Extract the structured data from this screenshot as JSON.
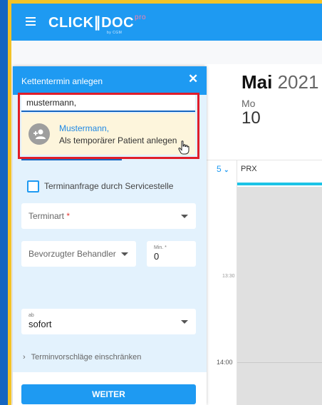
{
  "app": {
    "logo_text": "CLICK∥DOC",
    "logo_pro": "pro",
    "logo_by": "by CGM"
  },
  "calendar": {
    "month": "Mai",
    "year": "2021",
    "weekday": "Mo",
    "day": "10",
    "view_count": "5",
    "column_label": "PRX",
    "time_1": "13:30",
    "time_2": "14:00"
  },
  "panel": {
    "title": "Kettentermin anlegen",
    "search_value": "mustermann,",
    "suggestion_name": "Mustermann,",
    "suggestion_action": "Als temporärer Patient anlegen",
    "checkbox_label": "Terminanfrage durch Servicestelle",
    "termin_label": "Terminart",
    "required_mark": "*",
    "behandler_label": "Bevorzugter Behandler",
    "min_label": "Min. *",
    "min_value": "0",
    "ab_label": "ab",
    "ab_value": "sofort",
    "expand_label": "Terminvorschläge einschränken",
    "button_label": "WEITER"
  },
  "colors": {
    "brand_blue": "#1e9af2",
    "highlight_red": "#e01d2a",
    "accent_cyan": "#1cc3e6"
  }
}
